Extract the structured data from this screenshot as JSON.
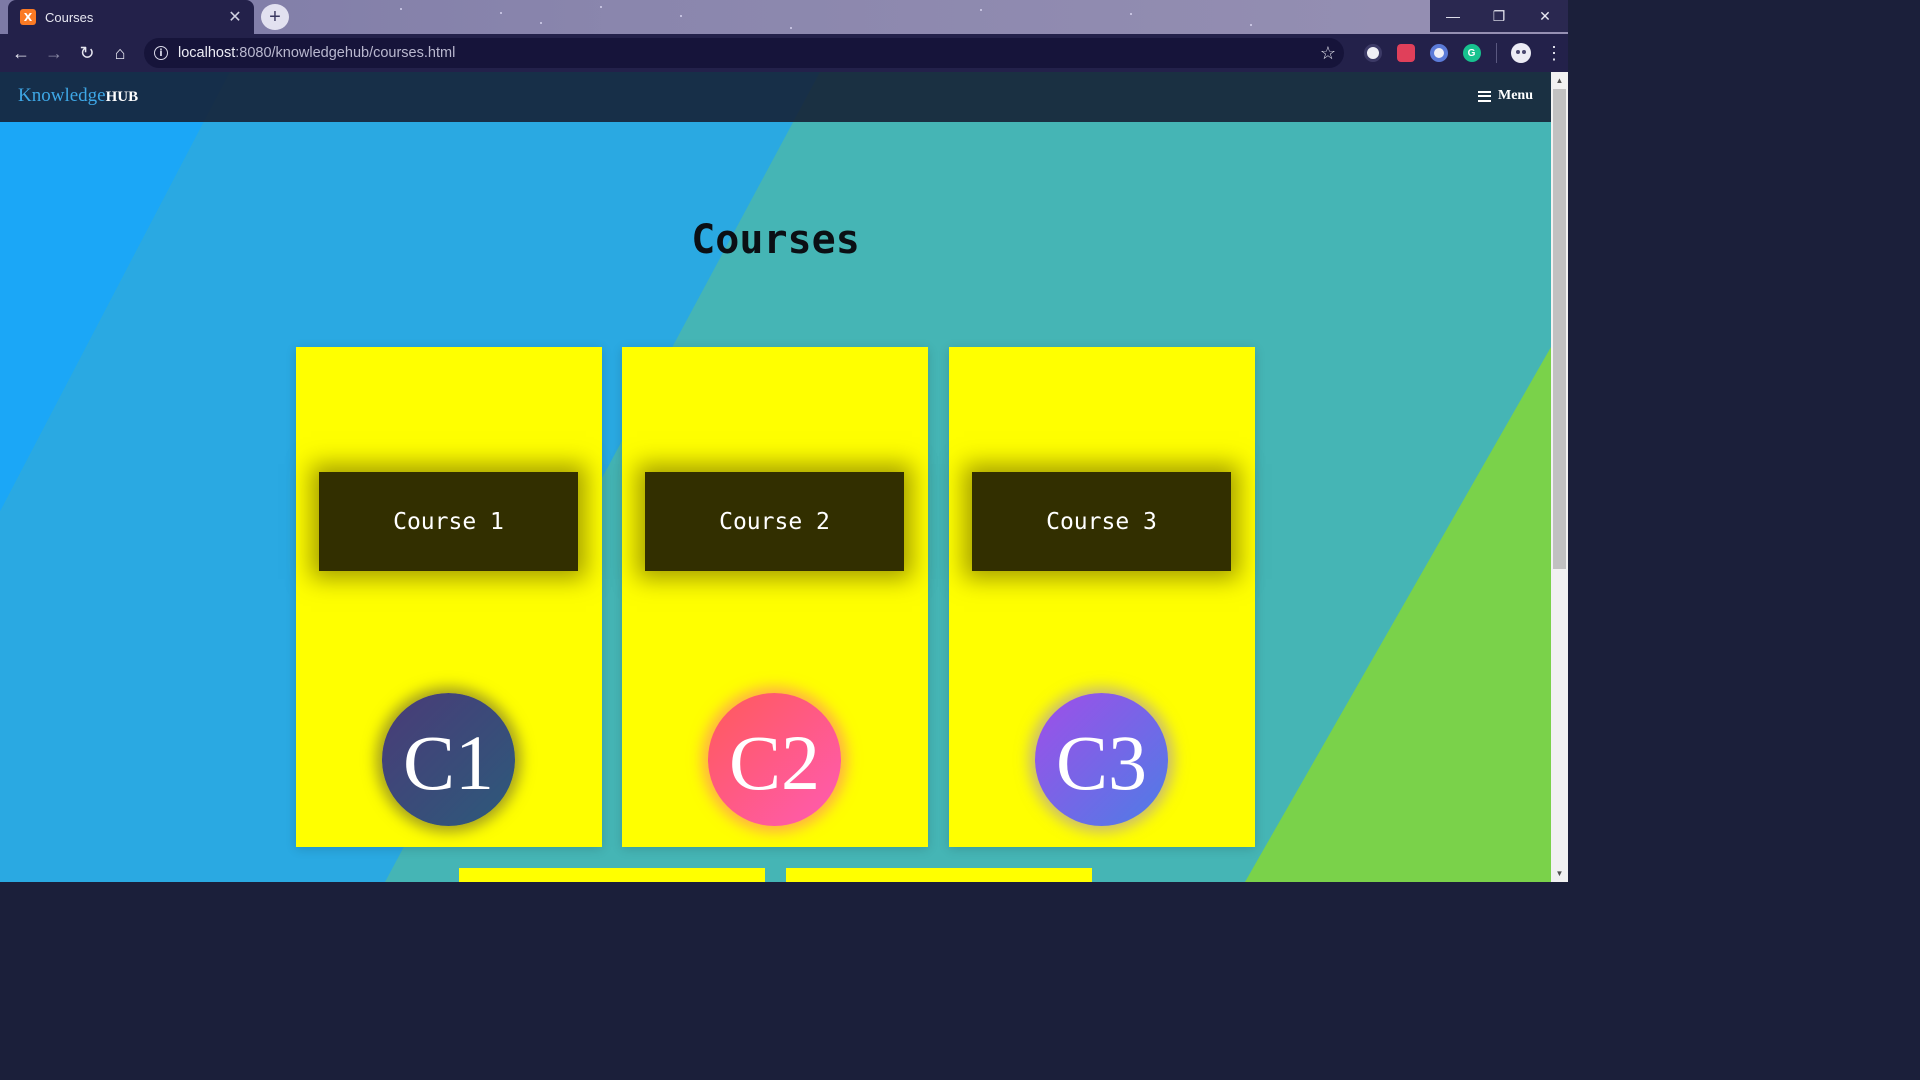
{
  "browser": {
    "tab_title": "Courses",
    "tab_favicon_text": "X",
    "url_host": "localhost",
    "url_path": ":8080/knowledgehub/courses.html"
  },
  "site": {
    "brand_part1": "Knowledge",
    "brand_part2": "HUB",
    "menu_label": "Menu"
  },
  "page": {
    "heading": "Courses"
  },
  "courses": [
    {
      "title": "Course 1",
      "badge": "C1"
    },
    {
      "title": "Course 2",
      "badge": "C2"
    },
    {
      "title": "Course 3",
      "badge": "C3"
    }
  ],
  "colors": {
    "card_yellow": "#ffff00",
    "card_title_bg": "#322f00",
    "bg_blue": "#1aa6f5",
    "bg_teal": "#45b5b5",
    "bg_green": "#7ad24a"
  }
}
